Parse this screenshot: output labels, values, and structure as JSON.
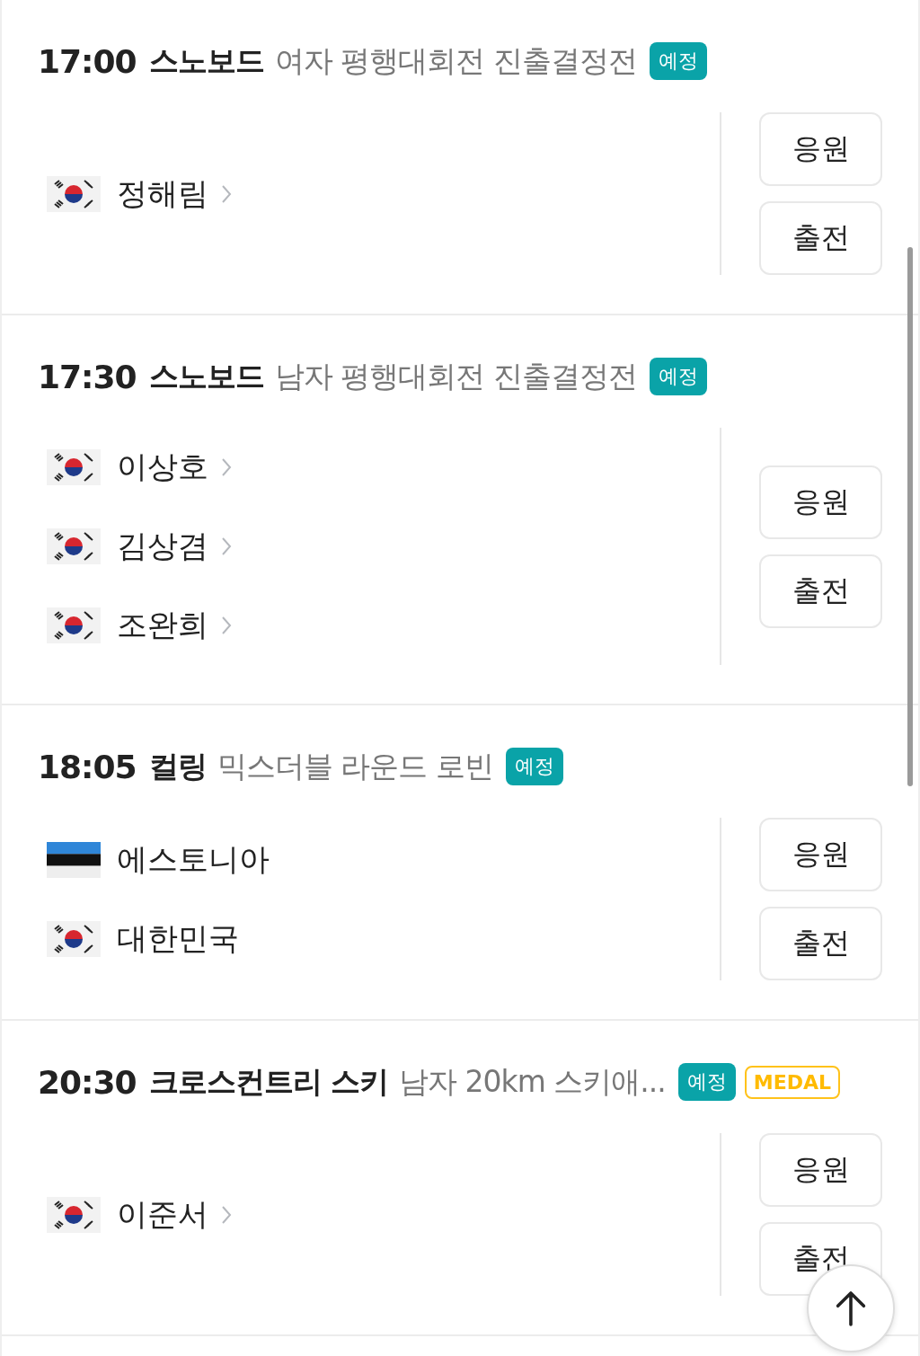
{
  "events": [
    {
      "time": "17:00",
      "sport": "스노보드",
      "event": "여자 평행대회전 진출결정전",
      "badges": [
        {
          "kind": "status",
          "label": "예정"
        }
      ],
      "participants": [
        {
          "name": "정해림",
          "kind": "korea",
          "link": true
        }
      ],
      "buttons": [
        "응원",
        "출전"
      ]
    },
    {
      "time": "17:30",
      "sport": "스노보드",
      "event": "남자 평행대회전 진출결정전",
      "badges": [
        {
          "kind": "status",
          "label": "예정"
        }
      ],
      "participants": [
        {
          "name": "이상호",
          "kind": "korea",
          "link": true
        },
        {
          "name": "김상겸",
          "kind": "korea",
          "link": true
        },
        {
          "name": "조완희",
          "kind": "korea",
          "link": true
        }
      ],
      "buttons": [
        "응원",
        "출전"
      ]
    },
    {
      "time": "18:05",
      "sport": "컬링",
      "event": "믹스더블 라운드 로빈",
      "badges": [
        {
          "kind": "status",
          "label": "예정"
        }
      ],
      "participants": [
        {
          "name": "에스토니아",
          "kind": "estonia",
          "link": false
        },
        {
          "name": "대한민국",
          "kind": "korea",
          "link": false
        }
      ],
      "buttons": [
        "응원",
        "출전"
      ]
    },
    {
      "time": "20:30",
      "sport": "크로스컨트리 스키",
      "event": "남자 20km 스키애...",
      "badges": [
        {
          "kind": "status",
          "label": "예정"
        },
        {
          "kind": "medal",
          "label": "MEDAL"
        }
      ],
      "participants": [
        {
          "name": "이준서",
          "kind": "korea",
          "link": true
        }
      ],
      "buttons": [
        "응원",
        "출전"
      ]
    }
  ]
}
